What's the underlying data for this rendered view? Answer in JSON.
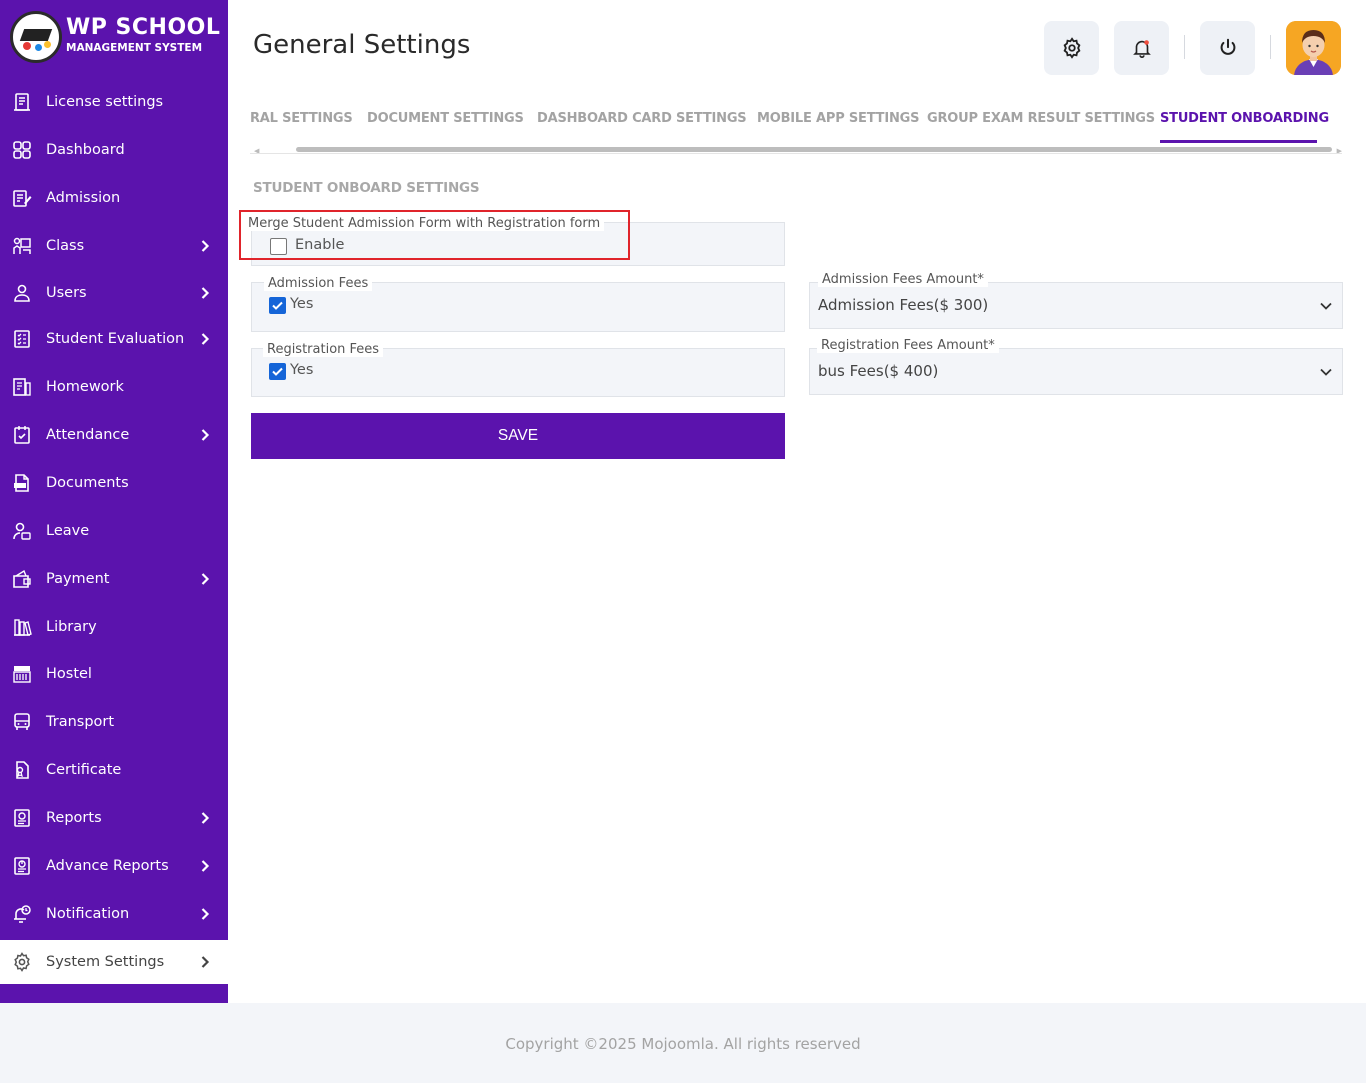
{
  "brand": {
    "title": "WP SCHOOL",
    "subtitle": "MANAGEMENT SYSTEM"
  },
  "sidebar": {
    "items": [
      {
        "label": "License settings",
        "icon": "license-icon",
        "has_arrow": false
      },
      {
        "label": "Dashboard",
        "icon": "dashboard-icon",
        "has_arrow": false
      },
      {
        "label": "Admission",
        "icon": "admission-icon",
        "has_arrow": false
      },
      {
        "label": "Class",
        "icon": "class-icon",
        "has_arrow": true
      },
      {
        "label": "Users",
        "icon": "user-icon",
        "has_arrow": true
      },
      {
        "label": "Student Evaluation",
        "icon": "evaluation-icon",
        "has_arrow": true
      },
      {
        "label": "Homework",
        "icon": "homework-icon",
        "has_arrow": false
      },
      {
        "label": "Attendance",
        "icon": "attendance-icon",
        "has_arrow": true
      },
      {
        "label": "Documents",
        "icon": "documents-icon",
        "has_arrow": false
      },
      {
        "label": "Leave",
        "icon": "leave-icon",
        "has_arrow": false
      },
      {
        "label": "Payment",
        "icon": "payment-icon",
        "has_arrow": true
      },
      {
        "label": "Library",
        "icon": "library-icon",
        "has_arrow": false
      },
      {
        "label": "Hostel",
        "icon": "hostel-icon",
        "has_arrow": false
      },
      {
        "label": "Transport",
        "icon": "transport-icon",
        "has_arrow": false
      },
      {
        "label": "Certificate",
        "icon": "certificate-icon",
        "has_arrow": false
      },
      {
        "label": "Reports",
        "icon": "reports-icon",
        "has_arrow": true
      },
      {
        "label": "Advance Reports",
        "icon": "advance-reports-icon",
        "has_arrow": true
      },
      {
        "label": "Notification",
        "icon": "notification-icon",
        "has_arrow": true
      },
      {
        "label": "System Settings",
        "icon": "gear-icon",
        "has_arrow": true,
        "active": true
      }
    ]
  },
  "header": {
    "title": "General Settings"
  },
  "tabs": [
    {
      "label": "RAL SETTINGS",
      "active": false
    },
    {
      "label": "DOCUMENT SETTINGS",
      "active": false
    },
    {
      "label": "DASHBOARD CARD SETTINGS",
      "active": false
    },
    {
      "label": "MOBILE APP SETTINGS",
      "active": false
    },
    {
      "label": "GROUP EXAM RESULT SETTINGS",
      "active": false
    },
    {
      "label": "STUDENT ONBOARDING",
      "active": true
    }
  ],
  "form": {
    "section_title": "STUDENT ONBOARD SETTINGS",
    "merge": {
      "legend": "Merge Student Admission Form with Registration form",
      "checkbox_label": "Enable",
      "checked": false
    },
    "admission_fees": {
      "legend": "Admission Fees",
      "checkbox_label": "Yes",
      "checked": true
    },
    "registration_fees": {
      "legend": "Registration Fees",
      "checkbox_label": "Yes",
      "checked": true
    },
    "admission_amount": {
      "legend": "Admission Fees Amount*",
      "value": "Admission Fees($ 300)"
    },
    "registration_amount": {
      "legend": "Registration Fees Amount*",
      "value": "bus Fees($ 400)"
    },
    "save_label": "SAVE"
  },
  "footer": {
    "text": "Copyright ©2025 Mojoomla. All rights reserved"
  },
  "colors": {
    "primary": "#5b13ad",
    "checkbox": "#1565d8",
    "highlight": "#e0242b",
    "field_bg": "#f3f5f9"
  }
}
